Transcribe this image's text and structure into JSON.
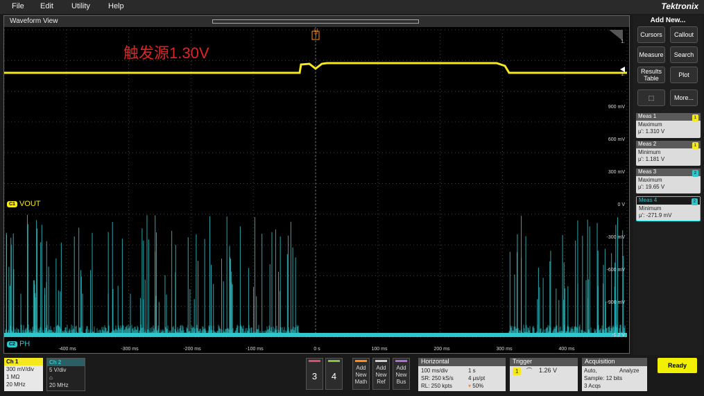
{
  "menu": {
    "file": "File",
    "edit": "Edit",
    "utility": "Utility",
    "help": "Help",
    "brand": "Tektronix"
  },
  "waveform": {
    "title": "Waveform View",
    "annotation": "触发源1.30V",
    "trigger_markers": [
      "U",
      "T"
    ],
    "right_scale": [
      "1.",
      "1.",
      "900 mV",
      "600 mV",
      "300 mV",
      "0 V",
      "-300 mV",
      "-600 mV",
      "-900 mV",
      "-1.2 V"
    ],
    "time_labels": [
      "-400 ms",
      "-300 ms",
      "-200 ms",
      "-100 ms",
      "0 s",
      "100 ms",
      "200 ms",
      "300 ms",
      "400 ms"
    ],
    "ch1_label": "VOUT",
    "ch1_tag": "C1",
    "ch2_label": "PH",
    "ch2_tag": "C2",
    "colors": {
      "ch1": "#f5e81c",
      "ch2": "#2fc6cc",
      "trigger": "#ff8c1a"
    }
  },
  "side": {
    "add_new": "Add New...",
    "buttons": [
      "Cursors",
      "Callout",
      "Measure",
      "Search",
      "Results Table",
      "Plot",
      "More..."
    ],
    "meas": [
      {
        "title": "Meas 1",
        "type": "Maximum",
        "value": "μ': 1.310 V",
        "ch": "1"
      },
      {
        "title": "Meas 2",
        "type": "Minimum",
        "value": "μ': 1.181 V",
        "ch": "1"
      },
      {
        "title": "Meas 3",
        "type": "Maximum",
        "value": "μ': 19.65 V",
        "ch": "2"
      },
      {
        "title": "Meas 4",
        "type": "Minimum",
        "value": "μ': -271.9 mV",
        "ch": "2"
      }
    ]
  },
  "bottom": {
    "ch1": {
      "title": "Ch 1",
      "scale": "300 mV/div",
      "imp": "1 MΩ",
      "bw": "20 MHz"
    },
    "ch2": {
      "title": "Ch 2",
      "scale": "5 V/div",
      "imp": "",
      "bw": "20 MHz"
    },
    "num3": "3",
    "num4": "4",
    "add_math": "Add New Math",
    "add_ref": "Add New Ref",
    "add_bus": "Add New Bus",
    "horizontal": {
      "title": "Horizontal",
      "a1": "100 ms/div",
      "a2": "1 s",
      "b1": "SR: 250 kS/s",
      "b2": "4 μs/pt",
      "c1": "RL: 250 kpts",
      "c2": "50%"
    },
    "trigger": {
      "title": "Trigger",
      "ch": "1",
      "level": "1.26 V"
    },
    "acquisition": {
      "title": "Acquisition",
      "a1": "Auto,",
      "a2": "Analyze",
      "b1": "Sample: 12 bits",
      "c1": "3 Acqs"
    },
    "ready": "Ready"
  }
}
